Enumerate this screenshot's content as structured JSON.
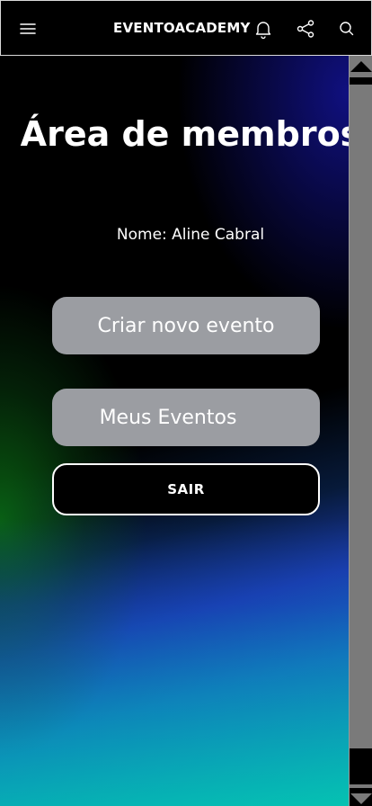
{
  "header": {
    "brand": "EVENTOACADEMY",
    "icons": [
      "menu-icon",
      "bell-icon",
      "share-icon",
      "search-icon"
    ]
  },
  "main": {
    "title": "Área de membros",
    "name_label": "Nome: Aline Cabral",
    "create_event_label": "Criar novo evento",
    "my_events_label": "Meus Eventos",
    "exit_label": "SAIR"
  },
  "colors": {
    "header_bg": "#000000",
    "button_grey": "#9b9da2",
    "scrollbar": "#7a7a7a"
  }
}
